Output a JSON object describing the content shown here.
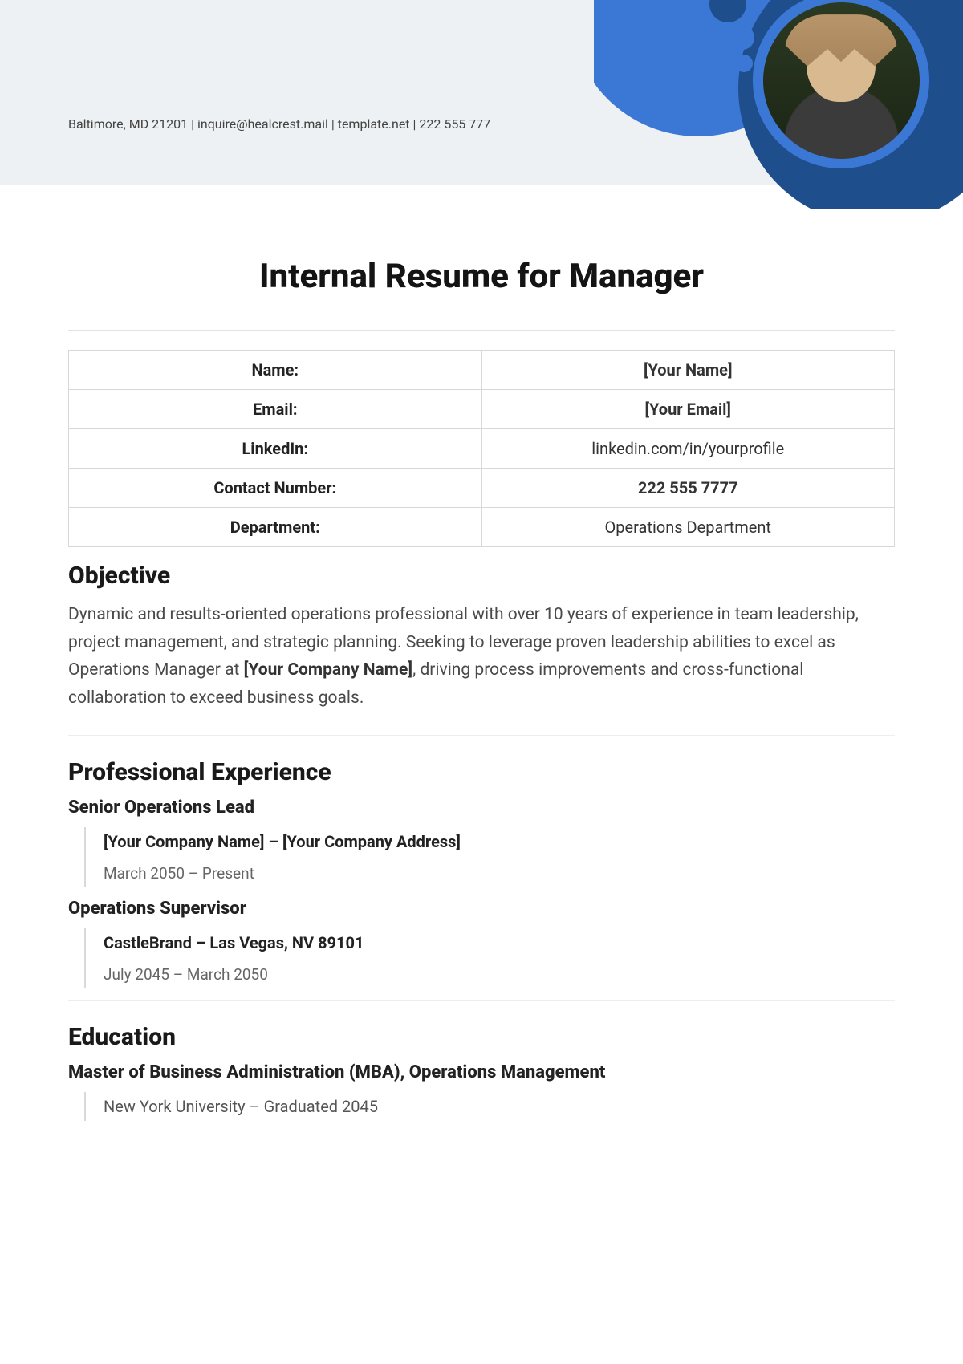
{
  "header": {
    "contact_line": "Baltimore, MD 21201 | inquire@healcrest.mail | template.net | 222 555 777"
  },
  "title": "Internal Resume for Manager",
  "info": [
    {
      "label": "Name:",
      "value": "[Your Name]",
      "bold": true
    },
    {
      "label": "Email:",
      "value": "[Your Email]",
      "bold": true
    },
    {
      "label": "LinkedIn:",
      "value": "linkedin.com/in/yourprofile",
      "bold": false
    },
    {
      "label": "Contact Number:",
      "value": "222 555 7777",
      "bold": true
    },
    {
      "label": "Department:",
      "value": "Operations Department",
      "bold": false
    }
  ],
  "objective": {
    "heading": "Objective",
    "text_pre": "Dynamic and results-oriented operations professional with over 10 years of experience in team leadership, project management, and strategic planning. Seeking to leverage proven leadership abilities to excel as Operations Manager at ",
    "text_bold": "[Your Company Name]",
    "text_post": ", driving process improvements and cross-functional collaboration to exceed business goals."
  },
  "experience": {
    "heading": "Professional Experience",
    "jobs": [
      {
        "title": "Senior Operations Lead",
        "company_bold": "[Your Company Name] – [Your Company Address]",
        "company_rest": "",
        "dates": "March 2050 – Present"
      },
      {
        "title": "Operations Supervisor",
        "company_bold": "CastleBrand –",
        "company_rest": " Las Vegas, NV 89101",
        "dates": "July 2045 – March 2050"
      }
    ]
  },
  "education": {
    "heading": "Education",
    "degree": "Master of Business Administration (MBA), Operations Management",
    "school": "New York University – Graduated 2045"
  }
}
